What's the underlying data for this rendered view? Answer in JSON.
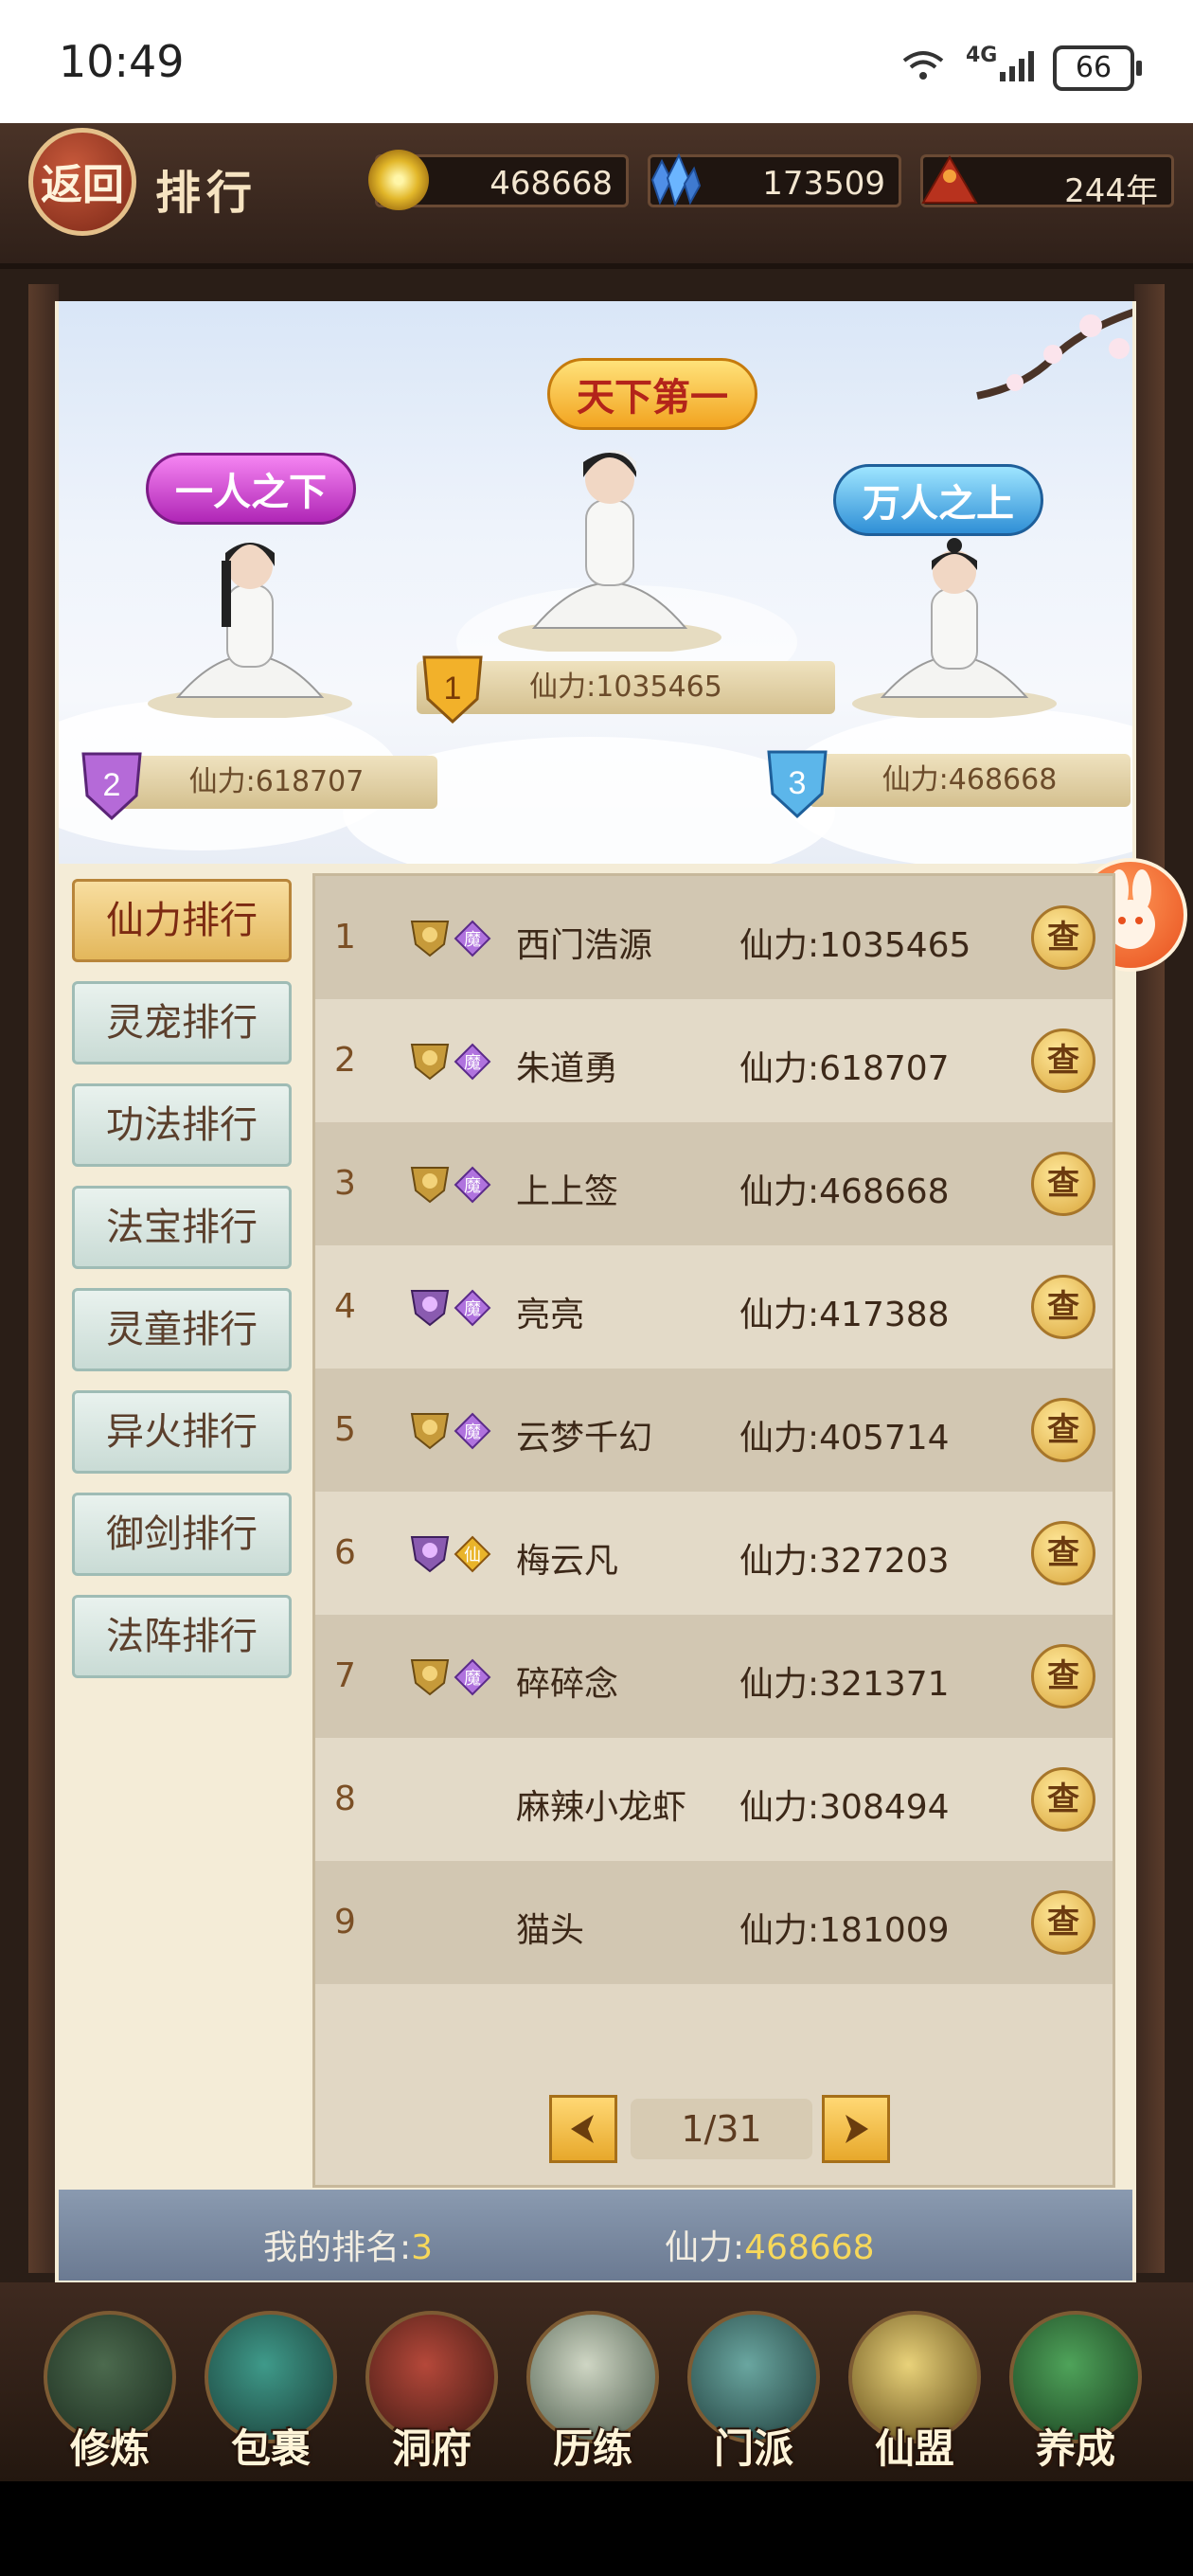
{
  "status_bar": {
    "time": "10:49",
    "signal": "4G",
    "battery": "66"
  },
  "header": {
    "back_label": "返回",
    "title": "排行",
    "resources": [
      {
        "icon": "coin-icon",
        "value": "468668"
      },
      {
        "icon": "crystal-icon",
        "value": "173509"
      },
      {
        "icon": "age-icon",
        "value": "244年"
      }
    ]
  },
  "podium": {
    "first": {
      "title": "天下第一",
      "rank": "1",
      "power": "仙力:1035465"
    },
    "second": {
      "title": "一人之下",
      "rank": "2",
      "power": "仙力:618707"
    },
    "third": {
      "title": "万人之上",
      "rank": "3",
      "power": "仙力:468668"
    }
  },
  "tabs": [
    {
      "label": "仙力排行",
      "active": true
    },
    {
      "label": "灵宠排行"
    },
    {
      "label": "功法排行"
    },
    {
      "label": "法宝排行"
    },
    {
      "label": "灵童排行"
    },
    {
      "label": "异火排行"
    },
    {
      "label": "御剑排行"
    },
    {
      "label": "法阵排行"
    }
  ],
  "rankings": [
    {
      "rank": "1",
      "medal": "gold-medal-icon",
      "tag": "魔",
      "name": "西门浩源",
      "power": "仙力:1035465",
      "view": "查"
    },
    {
      "rank": "2",
      "medal": "gold-medal-icon",
      "tag": "魔",
      "name": "朱道勇",
      "power": "仙力:618707",
      "view": "查"
    },
    {
      "rank": "3",
      "medal": "gold-medal-icon",
      "tag": "魔",
      "name": "上上签",
      "power": "仙力:468668",
      "view": "查"
    },
    {
      "rank": "4",
      "medal": "purple-medal-icon",
      "tag": "魔",
      "name": "亮亮",
      "power": "仙力:417388",
      "view": "查"
    },
    {
      "rank": "5",
      "medal": "gold-medal-icon",
      "tag": "魔",
      "name": "云梦千幻",
      "power": "仙力:405714",
      "view": "查"
    },
    {
      "rank": "6",
      "medal": "purple-medal-icon",
      "tag": "仙",
      "name": "梅云凡",
      "power": "仙力:327203",
      "view": "查"
    },
    {
      "rank": "7",
      "medal": "gold-medal-icon",
      "tag": "魔",
      "name": "碎碎念",
      "power": "仙力:321371",
      "view": "查"
    },
    {
      "rank": "8",
      "name": "麻辣小龙虾",
      "power": "仙力:308494",
      "view": "查"
    },
    {
      "rank": "9",
      "name": "猫头",
      "power": "仙力:181009",
      "view": "查"
    }
  ],
  "pagination": {
    "page": "1/31"
  },
  "my_rank": {
    "rank_label": "我的排名:",
    "rank_value": "3",
    "power_label": "仙力:",
    "power_value": "468668"
  },
  "bottom_nav": [
    {
      "label": "修炼"
    },
    {
      "label": "包裹"
    },
    {
      "label": "洞府"
    },
    {
      "label": "历练"
    },
    {
      "label": "门派"
    },
    {
      "label": "仙盟"
    },
    {
      "label": "养成"
    }
  ],
  "colors": {
    "accent_gold": "#e3b75b",
    "my_rank_value": "#f7d85a",
    "tab_active_text": "#7c2a12"
  }
}
